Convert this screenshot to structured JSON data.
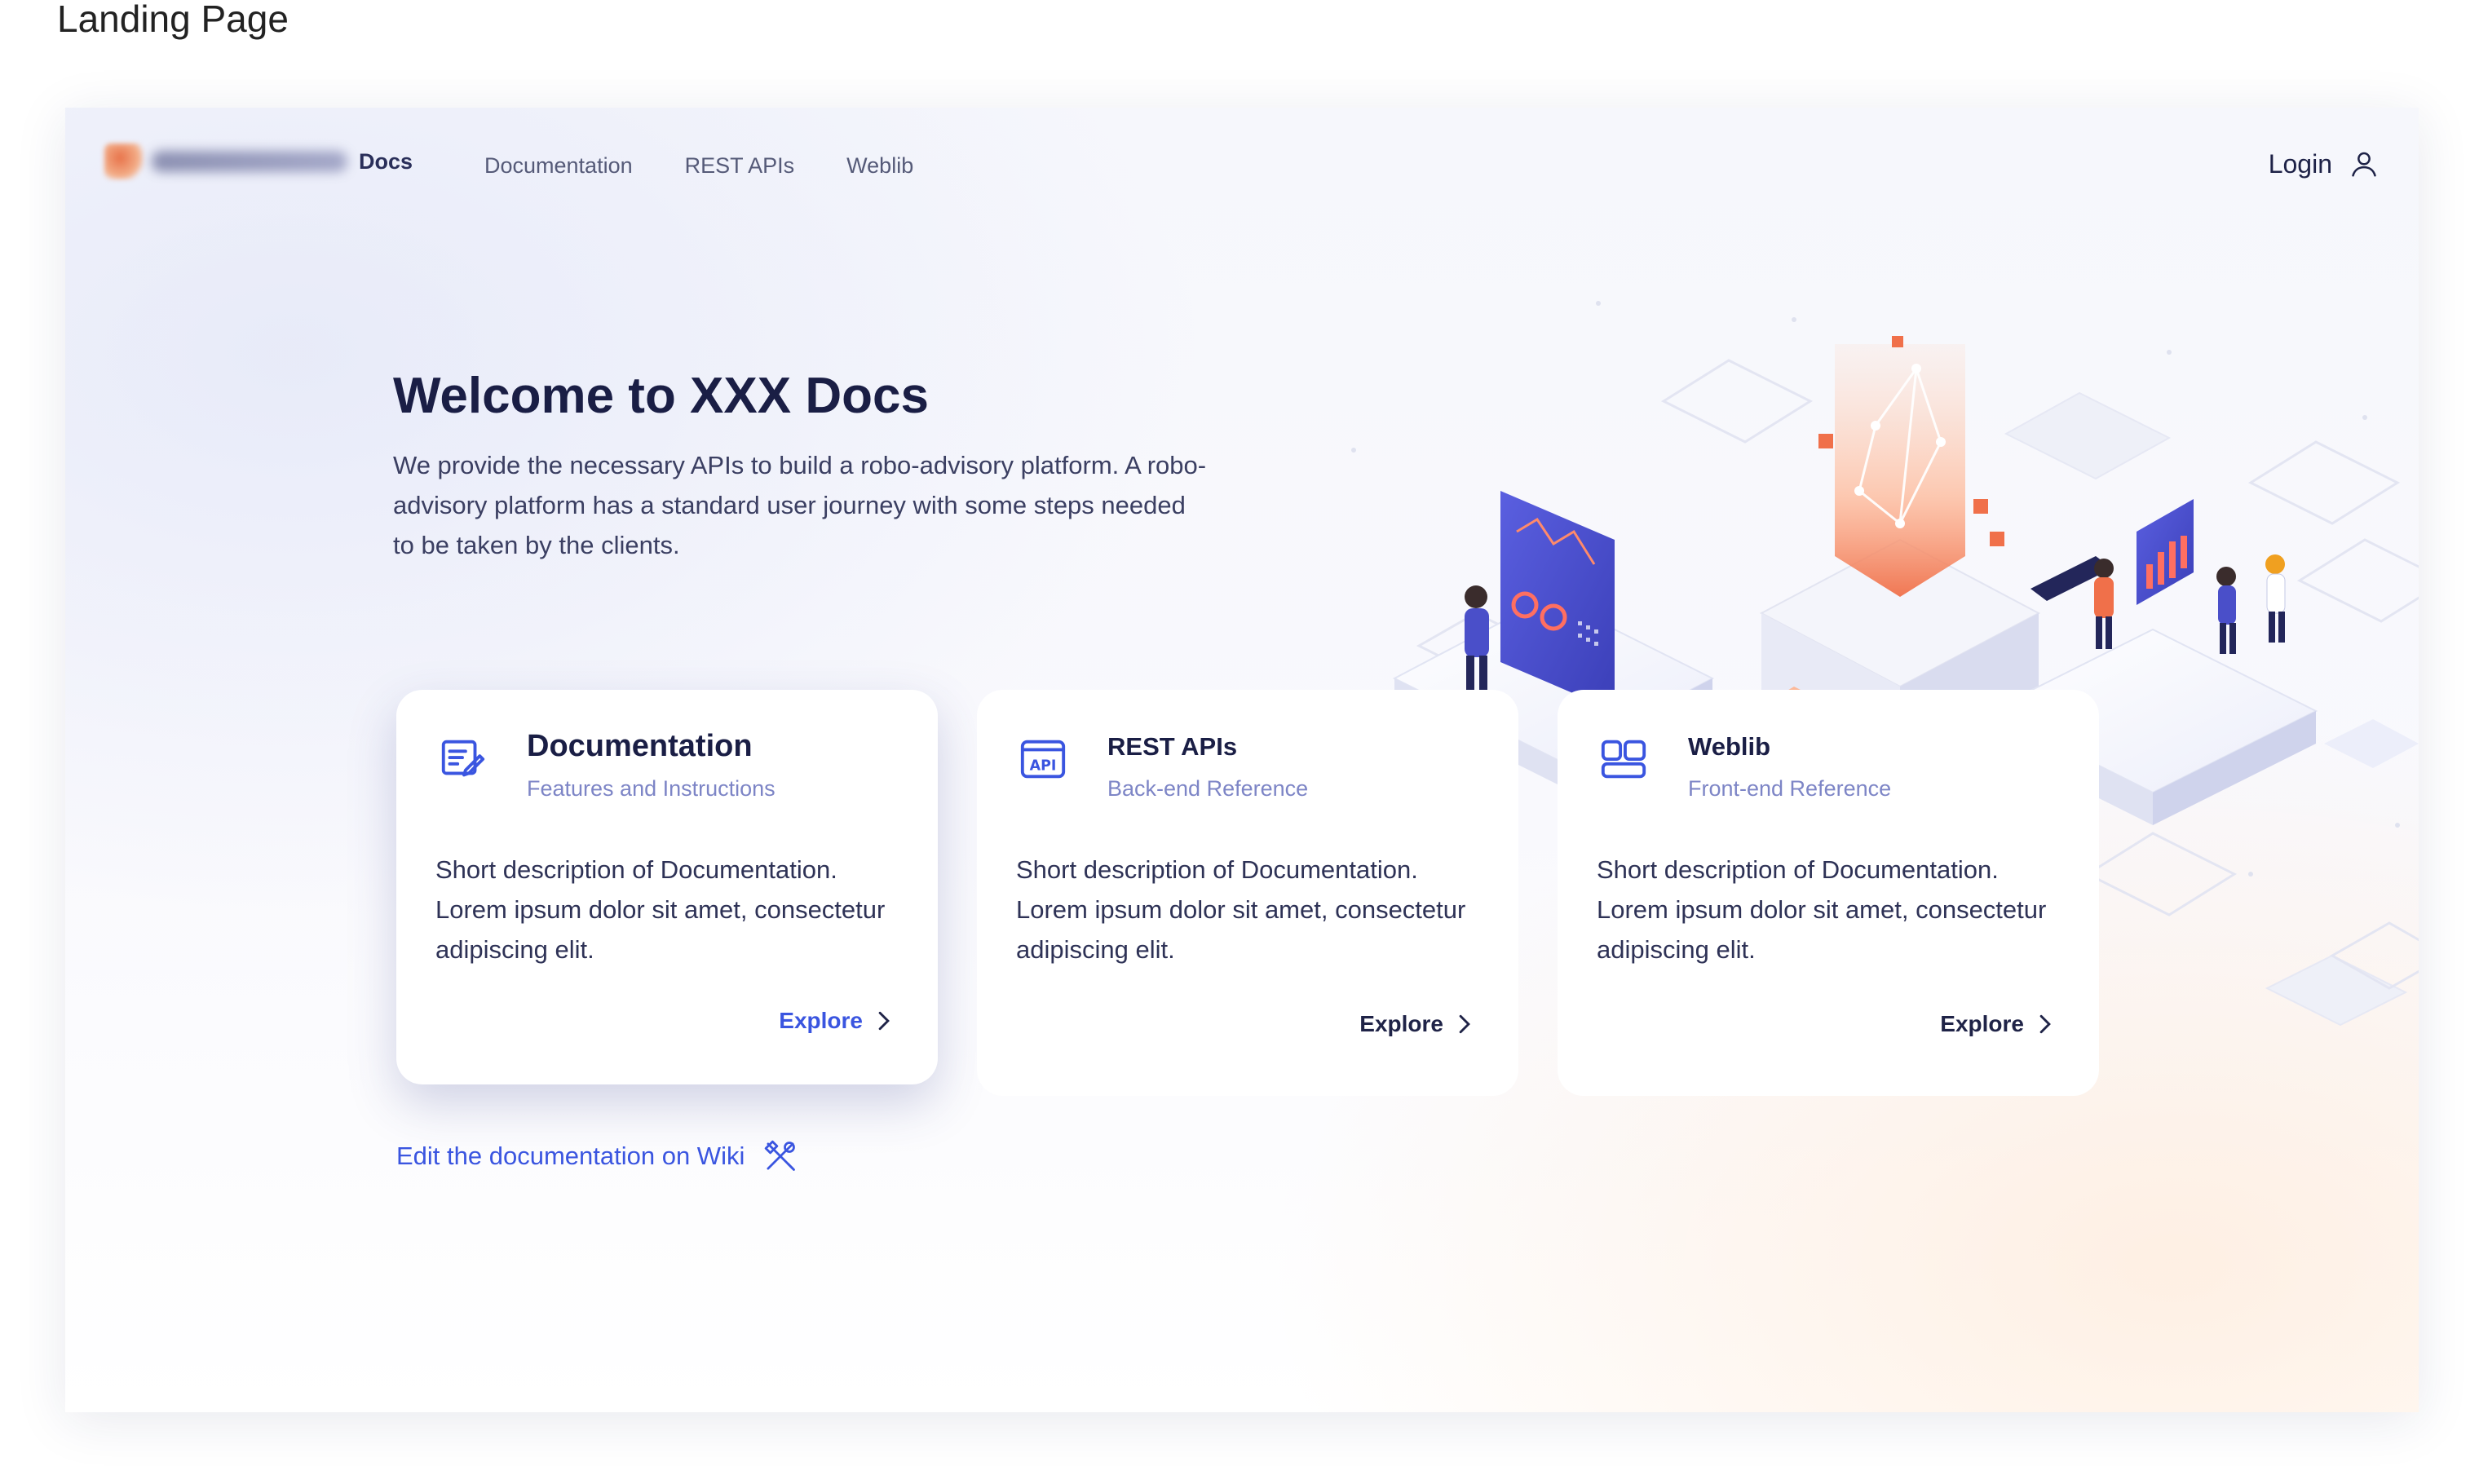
{
  "page_label": "Landing Page",
  "header": {
    "brand_suffix": "Docs",
    "nav": [
      "Documentation",
      "REST APIs",
      "Weblib"
    ],
    "login_label": "Login"
  },
  "hero": {
    "title": "Welcome to XXX Docs",
    "description": "We provide the necessary APIs to build a robo-advisory platform. A robo-advisory platform has a standard user journey with some steps needed to be taken by the clients."
  },
  "cards": [
    {
      "icon": "document-edit-icon",
      "title": "Documentation",
      "subtitle": "Features and Instructions",
      "description": "Short description of Documentation. Lorem ipsum dolor sit amet, consectetur adipiscing elit.",
      "cta": "Explore"
    },
    {
      "icon": "api-icon",
      "title": "REST APIs",
      "subtitle": "Back-end Reference",
      "description": "Short description of Documentation. Lorem ipsum dolor sit amet, consectetur adipiscing elit.",
      "cta": "Explore"
    },
    {
      "icon": "layout-blocks-icon",
      "title": "Weblib",
      "subtitle": "Front-end Reference",
      "description": "Short description of Documentation. Lorem ipsum dolor sit amet, consectetur adipiscing elit.",
      "cta": "Explore"
    }
  ],
  "wiki_link": "Edit the documentation on Wiki",
  "colors": {
    "accent": "#3a55e0",
    "heading": "#1a1e45",
    "subtitle": "#7d85c6",
    "illustration_orange": "#f0704a",
    "illustration_indigo": "#4a4fc9"
  }
}
